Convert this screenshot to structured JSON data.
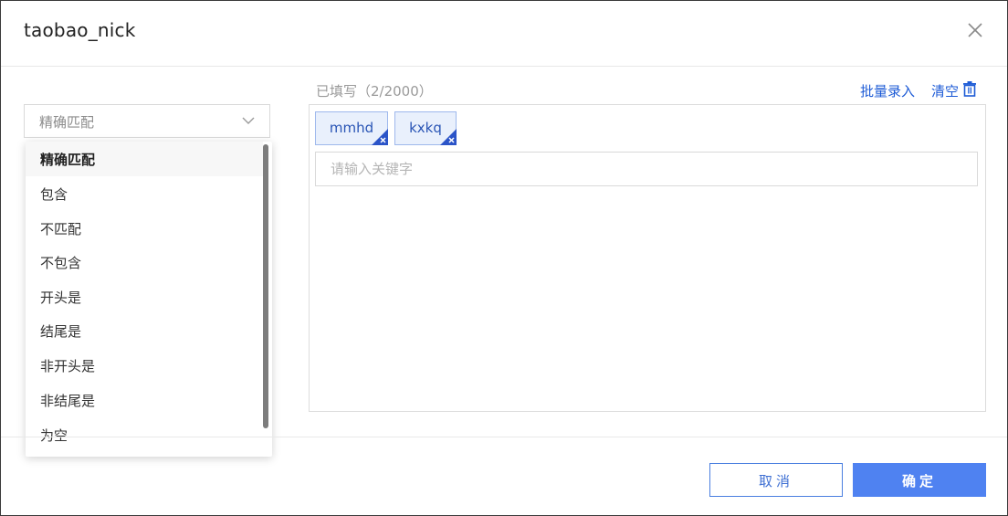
{
  "dialog": {
    "title": "taobao_nick",
    "close_icon": "close-icon"
  },
  "match_select": {
    "value": "精确匹配",
    "icon": "chevron-down-icon",
    "options": [
      "精确匹配",
      "包含",
      "不匹配",
      "不包含",
      "开头是",
      "结尾是",
      "非开头是",
      "非结尾是",
      "为空"
    ],
    "selected_index": 0
  },
  "keywords": {
    "count_label": "已填写（2/2000）",
    "batch_link": "批量录入",
    "clear_link": "清空",
    "clear_icon": "trash-icon",
    "tags": [
      "mmhd",
      "kxkq"
    ],
    "tag_remove_icon": "remove-tag-icon",
    "input_placeholder": "请输入关键字",
    "input_value": ""
  },
  "footer": {
    "cancel_label": "取消",
    "ok_label": "确定"
  },
  "colors": {
    "accent": "#4f82f1",
    "link": "#1d5bd6",
    "tag_bg": "#e9f0fc",
    "tag_corner": "#2b54c8"
  }
}
